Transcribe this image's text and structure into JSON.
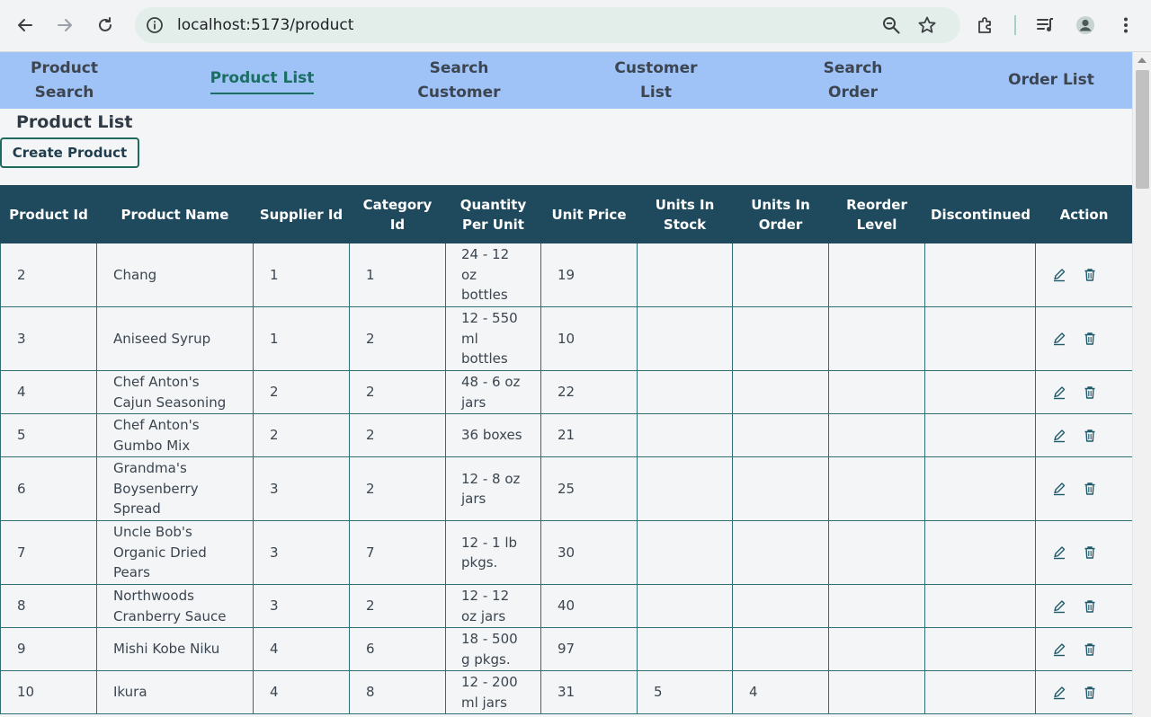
{
  "browser": {
    "url": "localhost:5173/product"
  },
  "nav": {
    "items": [
      {
        "label": "Product Search",
        "active": false
      },
      {
        "label": "Product List",
        "active": true
      },
      {
        "label": "Search Customer",
        "active": false
      },
      {
        "label": "Customer List",
        "active": false
      },
      {
        "label": "Search Order",
        "active": false
      },
      {
        "label": "Order List",
        "active": false
      }
    ]
  },
  "page": {
    "title": "Product List",
    "create_button": "Create Product"
  },
  "table": {
    "headers": [
      "Product Id",
      "Product Name",
      "Supplier Id",
      "Category Id",
      "Quantity Per Unit",
      "Unit Price",
      "Units In Stock",
      "Units In Order",
      "Reorder Level",
      "Discontinued",
      "Action"
    ],
    "rows": [
      {
        "id": "2",
        "name": "Chang",
        "supplier": "1",
        "category": "1",
        "qty": "24 - 12 oz bottles",
        "price": "19",
        "stock": "",
        "order": "",
        "reorder": "",
        "discontinued": ""
      },
      {
        "id": "3",
        "name": "Aniseed Syrup",
        "supplier": "1",
        "category": "2",
        "qty": "12 - 550 ml bottles",
        "price": "10",
        "stock": "",
        "order": "",
        "reorder": "",
        "discontinued": ""
      },
      {
        "id": "4",
        "name": "Chef Anton's Cajun Seasoning",
        "supplier": "2",
        "category": "2",
        "qty": "48 - 6 oz jars",
        "price": "22",
        "stock": "",
        "order": "",
        "reorder": "",
        "discontinued": ""
      },
      {
        "id": "5",
        "name": "Chef Anton's Gumbo Mix",
        "supplier": "2",
        "category": "2",
        "qty": "36 boxes",
        "price": "21",
        "stock": "",
        "order": "",
        "reorder": "",
        "discontinued": ""
      },
      {
        "id": "6",
        "name": "Grandma's Boysenberry Spread",
        "supplier": "3",
        "category": "2",
        "qty": "12 - 8 oz jars",
        "price": "25",
        "stock": "",
        "order": "",
        "reorder": "",
        "discontinued": ""
      },
      {
        "id": "7",
        "name": "Uncle Bob's Organic Dried Pears",
        "supplier": "3",
        "category": "7",
        "qty": "12 - 1 lb pkgs.",
        "price": "30",
        "stock": "",
        "order": "",
        "reorder": "",
        "discontinued": ""
      },
      {
        "id": "8",
        "name": "Northwoods Cranberry Sauce",
        "supplier": "3",
        "category": "2",
        "qty": "12 - 12 oz jars",
        "price": "40",
        "stock": "",
        "order": "",
        "reorder": "",
        "discontinued": ""
      },
      {
        "id": "9",
        "name": "Mishi Kobe Niku",
        "supplier": "4",
        "category": "6",
        "qty": "18 - 500 g pkgs.",
        "price": "97",
        "stock": "",
        "order": "",
        "reorder": "",
        "discontinued": ""
      },
      {
        "id": "10",
        "name": "Ikura",
        "supplier": "4",
        "category": "8",
        "qty": "12 - 200 ml jars",
        "price": "31",
        "stock": "5",
        "order": "4",
        "reorder": "",
        "discontinued": ""
      }
    ]
  },
  "colors": {
    "nav_bg": "#9fc2f7",
    "active_nav": "#1b6e63",
    "table_header_bg": "#1f4a5e",
    "cell_border": "#2f6f73"
  },
  "icons": {
    "row_actions": [
      "edit-icon",
      "delete-icon"
    ]
  }
}
